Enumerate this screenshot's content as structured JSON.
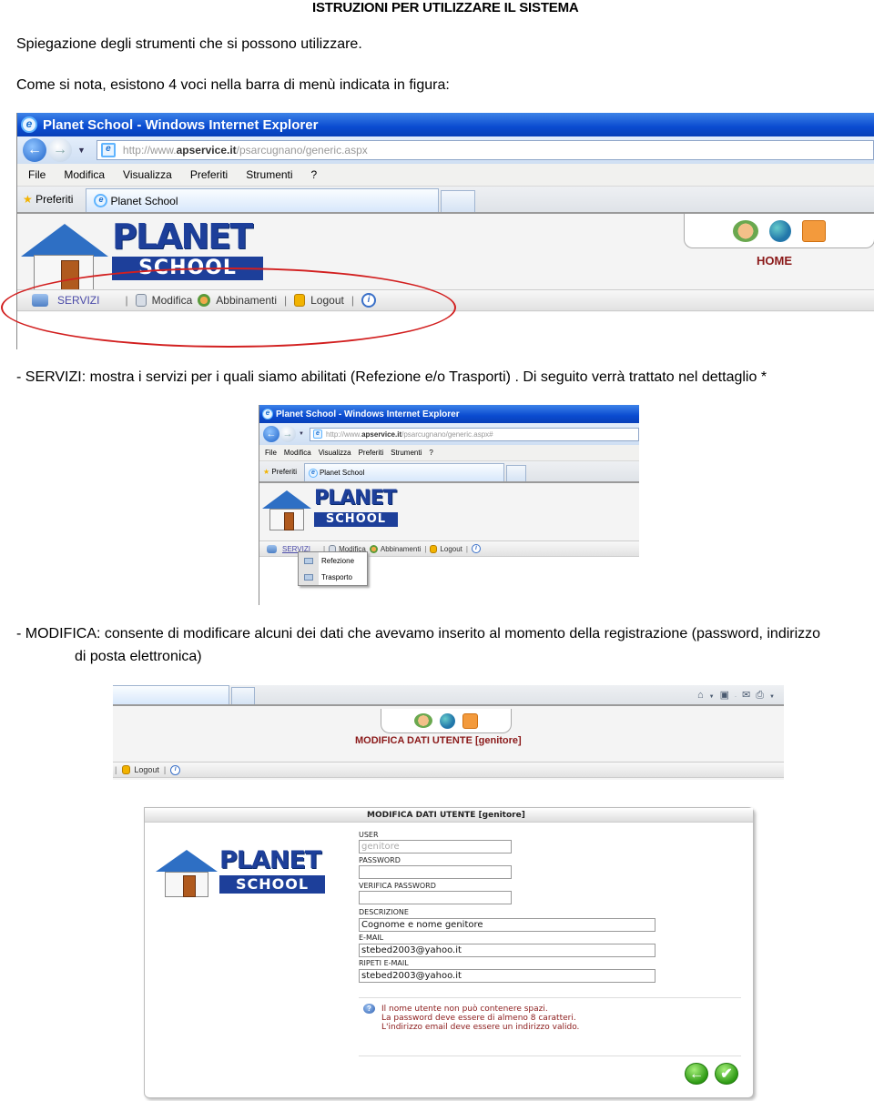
{
  "document": {
    "title": "ISTRUZIONI PER UTILIZZARE IL SISTEMA",
    "intro": "Spiegazione degli strumenti che si possono utilizzare.",
    "menu_note": "Come si nota, esistono 4 voci nella barra di menù indicata in figura:",
    "servizi_desc": "- SERVIZI: mostra i servizi per i quali siamo abilitati (Refezione e/o Trasporti) . Di seguito verrà trattato nel dettaglio *",
    "modifica_desc_1": "- MODIFICA: consente di modificare alcuni dei dati che avevamo inserito al momento della registrazione (password, indirizzo",
    "modifica_desc_2": "di posta elettronica)"
  },
  "browser": {
    "window_title": "Planet School - Windows Internet Explorer",
    "url_prefix": "http://www.",
    "url_domain": "apservice.it",
    "url_path": "/psarcugnano/generic.aspx",
    "url_path_2": "/psarcugnano/generic.aspx#",
    "menu": [
      "File",
      "Modifica",
      "Visualizza",
      "Preferiti",
      "Strumenti",
      "?"
    ],
    "favorites": "Preferiti",
    "tab_label": "Planet School"
  },
  "site": {
    "logo_line1": "PLANET",
    "logo_line2": "SCHOOL",
    "nav": {
      "servizi": "SERVIZI",
      "modifica": "Modifica",
      "abbinamenti": "Abbinamenti",
      "logout": "Logout",
      "separator": "|"
    },
    "home_label": "HOME",
    "servizi_menu": [
      "Refezione",
      "Trasporto"
    ],
    "page_heading": "MODIFICA DATI UTENTE [genitore]"
  },
  "form": {
    "title": "MODIFICA DATI UTENTE [genitore]",
    "fields": [
      {
        "label": "USER",
        "value": "genitore",
        "disabled": true
      },
      {
        "label": "PASSWORD",
        "value": ""
      },
      {
        "label": "VERIFICA PASSWORD",
        "value": ""
      },
      {
        "label": "DESCRIZIONE",
        "value": "Cognome e nome genitore"
      },
      {
        "label": "E-MAIL",
        "value": "stebed2003@yahoo.it"
      },
      {
        "label": "RIPETI E-MAIL",
        "value": "stebed2003@yahoo.it"
      }
    ],
    "hints": [
      "Il nome utente non può contenere spazi.",
      "La password deve essere di almeno 8 caratteri.",
      "L'indirizzo email deve essere un indirizzo valido."
    ]
  },
  "colors": {
    "ie_titlebar": "#0a4bd0",
    "highlight_ellipse": "#d21f1f",
    "home_red": "#8b1a1a",
    "logo_blue": "#1d3f9a"
  }
}
